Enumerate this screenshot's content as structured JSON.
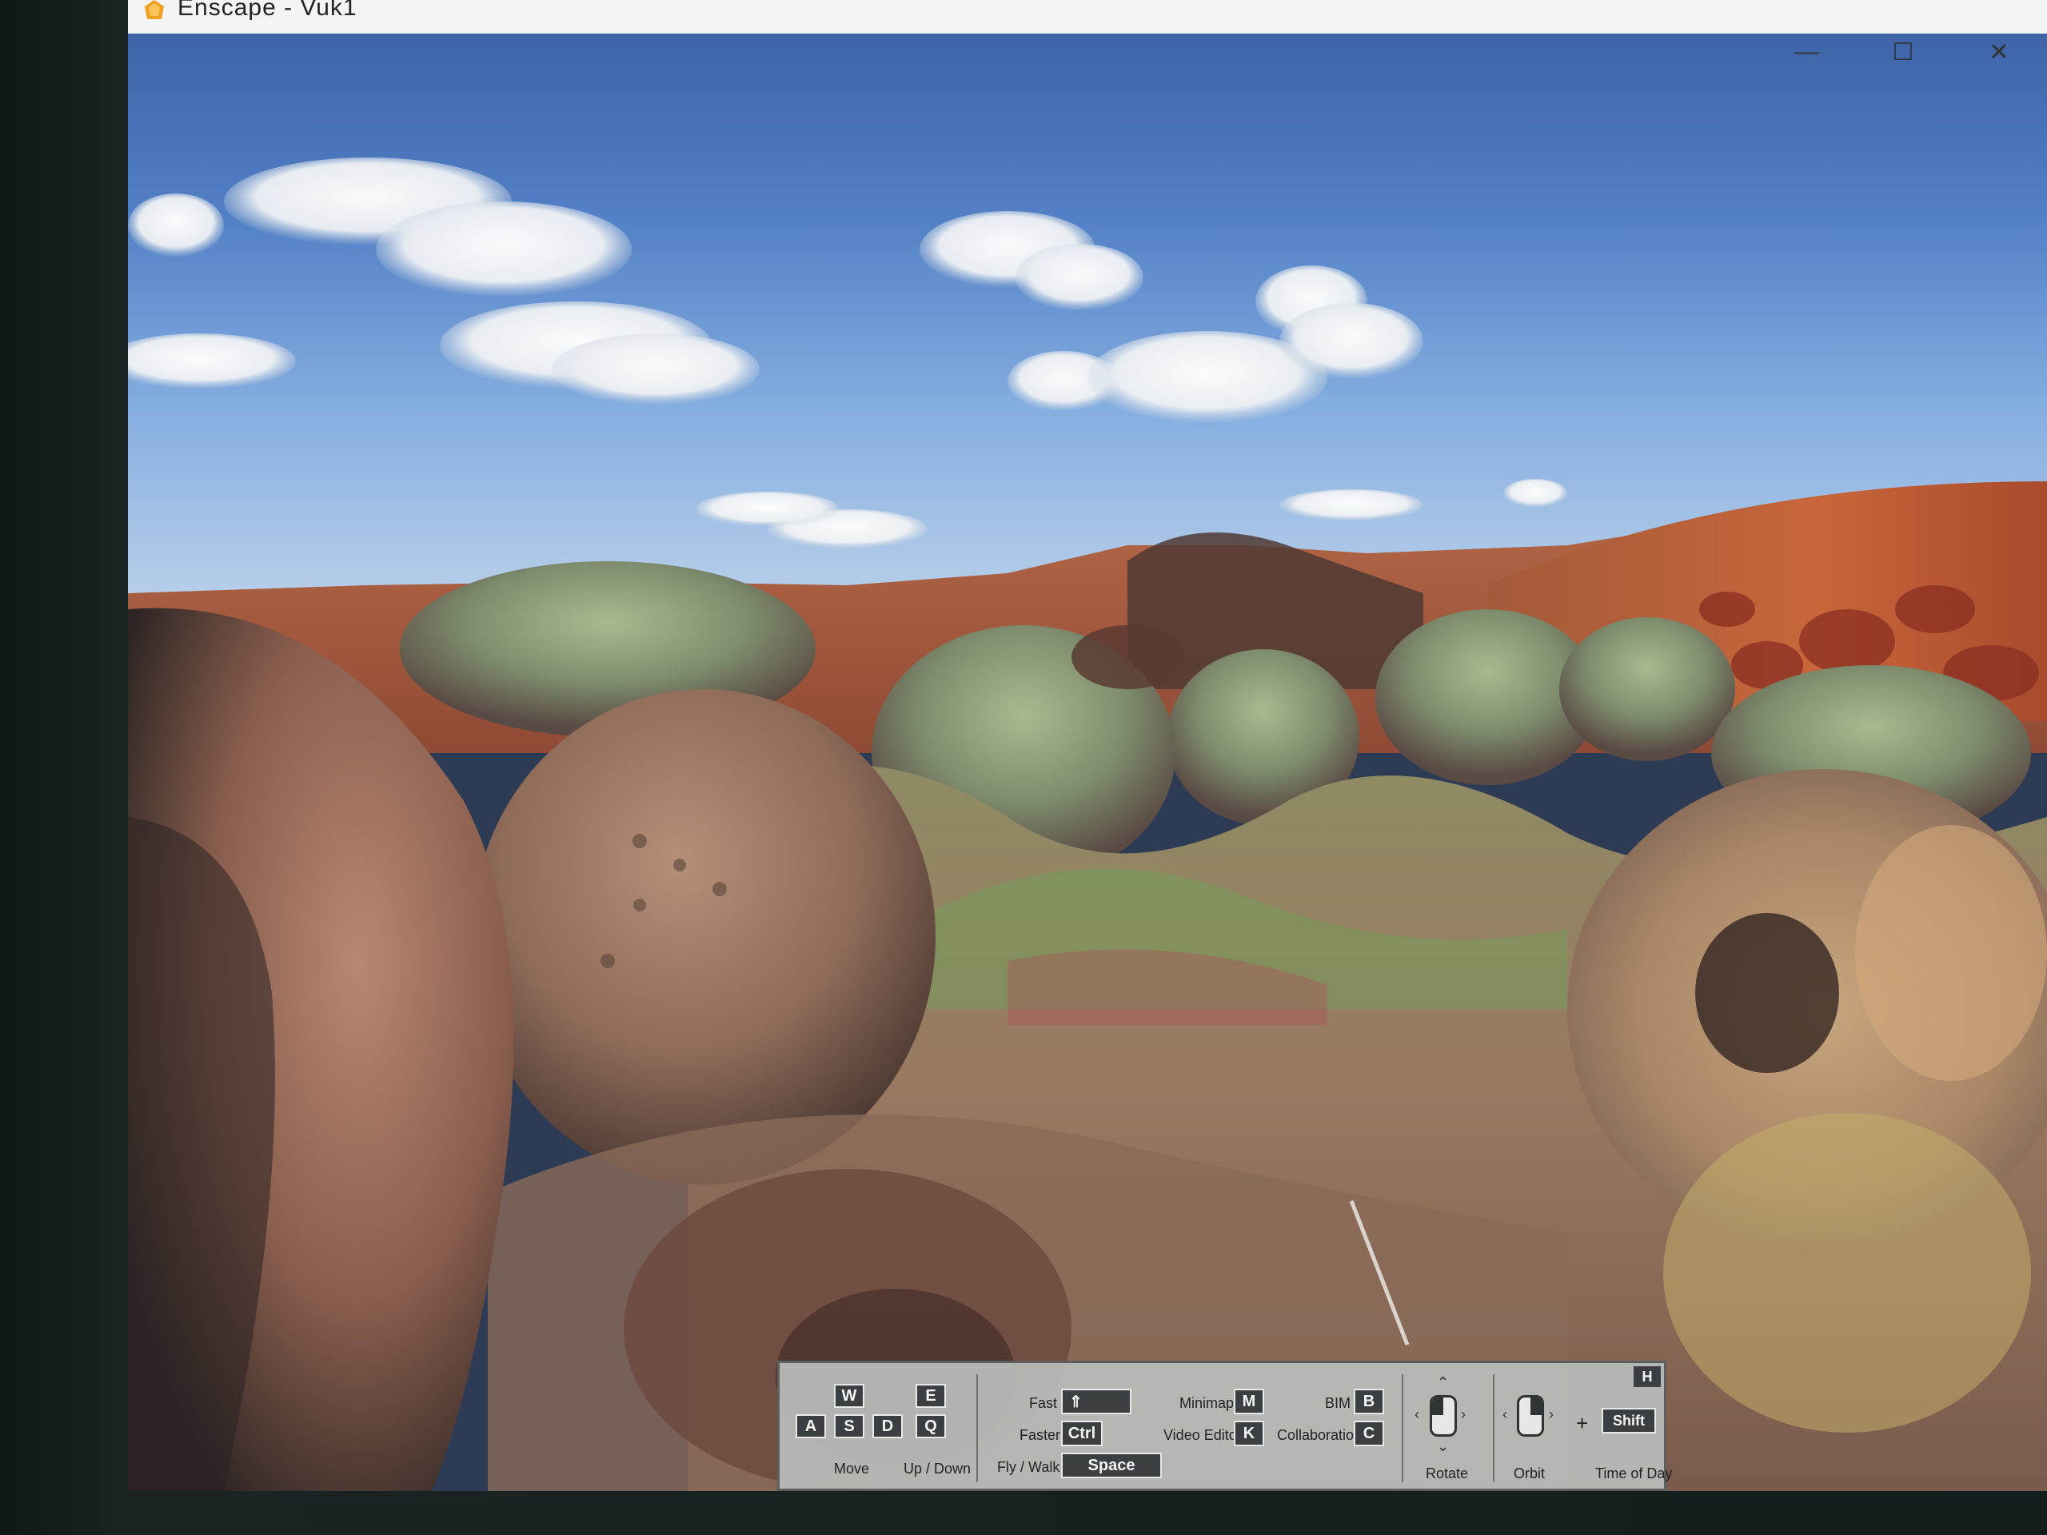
{
  "window": {
    "title": "Enscape - Vuk1",
    "minimize": "—",
    "maximize": "☐",
    "close": "✕"
  },
  "help": {
    "toggle": "H",
    "keys": {
      "w": "W",
      "a": "A",
      "s": "S",
      "d": "D",
      "e": "E",
      "q": "Q",
      "fast": "⇑",
      "faster": "Ctrl",
      "fly_walk": "Space",
      "minimap": "M",
      "video_editor": "K",
      "bim": "B",
      "collaboration": "C",
      "shift": "Shift"
    },
    "labels": {
      "move": "Move",
      "up_down": "Up / Down",
      "fast": "Fast",
      "faster": "Faster",
      "fly_walk": "Fly / Walk",
      "minimap": "Minimap",
      "video_editor": "Video Editor",
      "bim": "BIM",
      "collaboration": "Collaboration",
      "rotate": "Rotate",
      "orbit": "Orbit",
      "plus": "+",
      "time_of_day": "Time of Day"
    }
  },
  "colors": {
    "accent": "#f0a020",
    "panel": "#b9bcba",
    "key": "#3b3f41"
  }
}
